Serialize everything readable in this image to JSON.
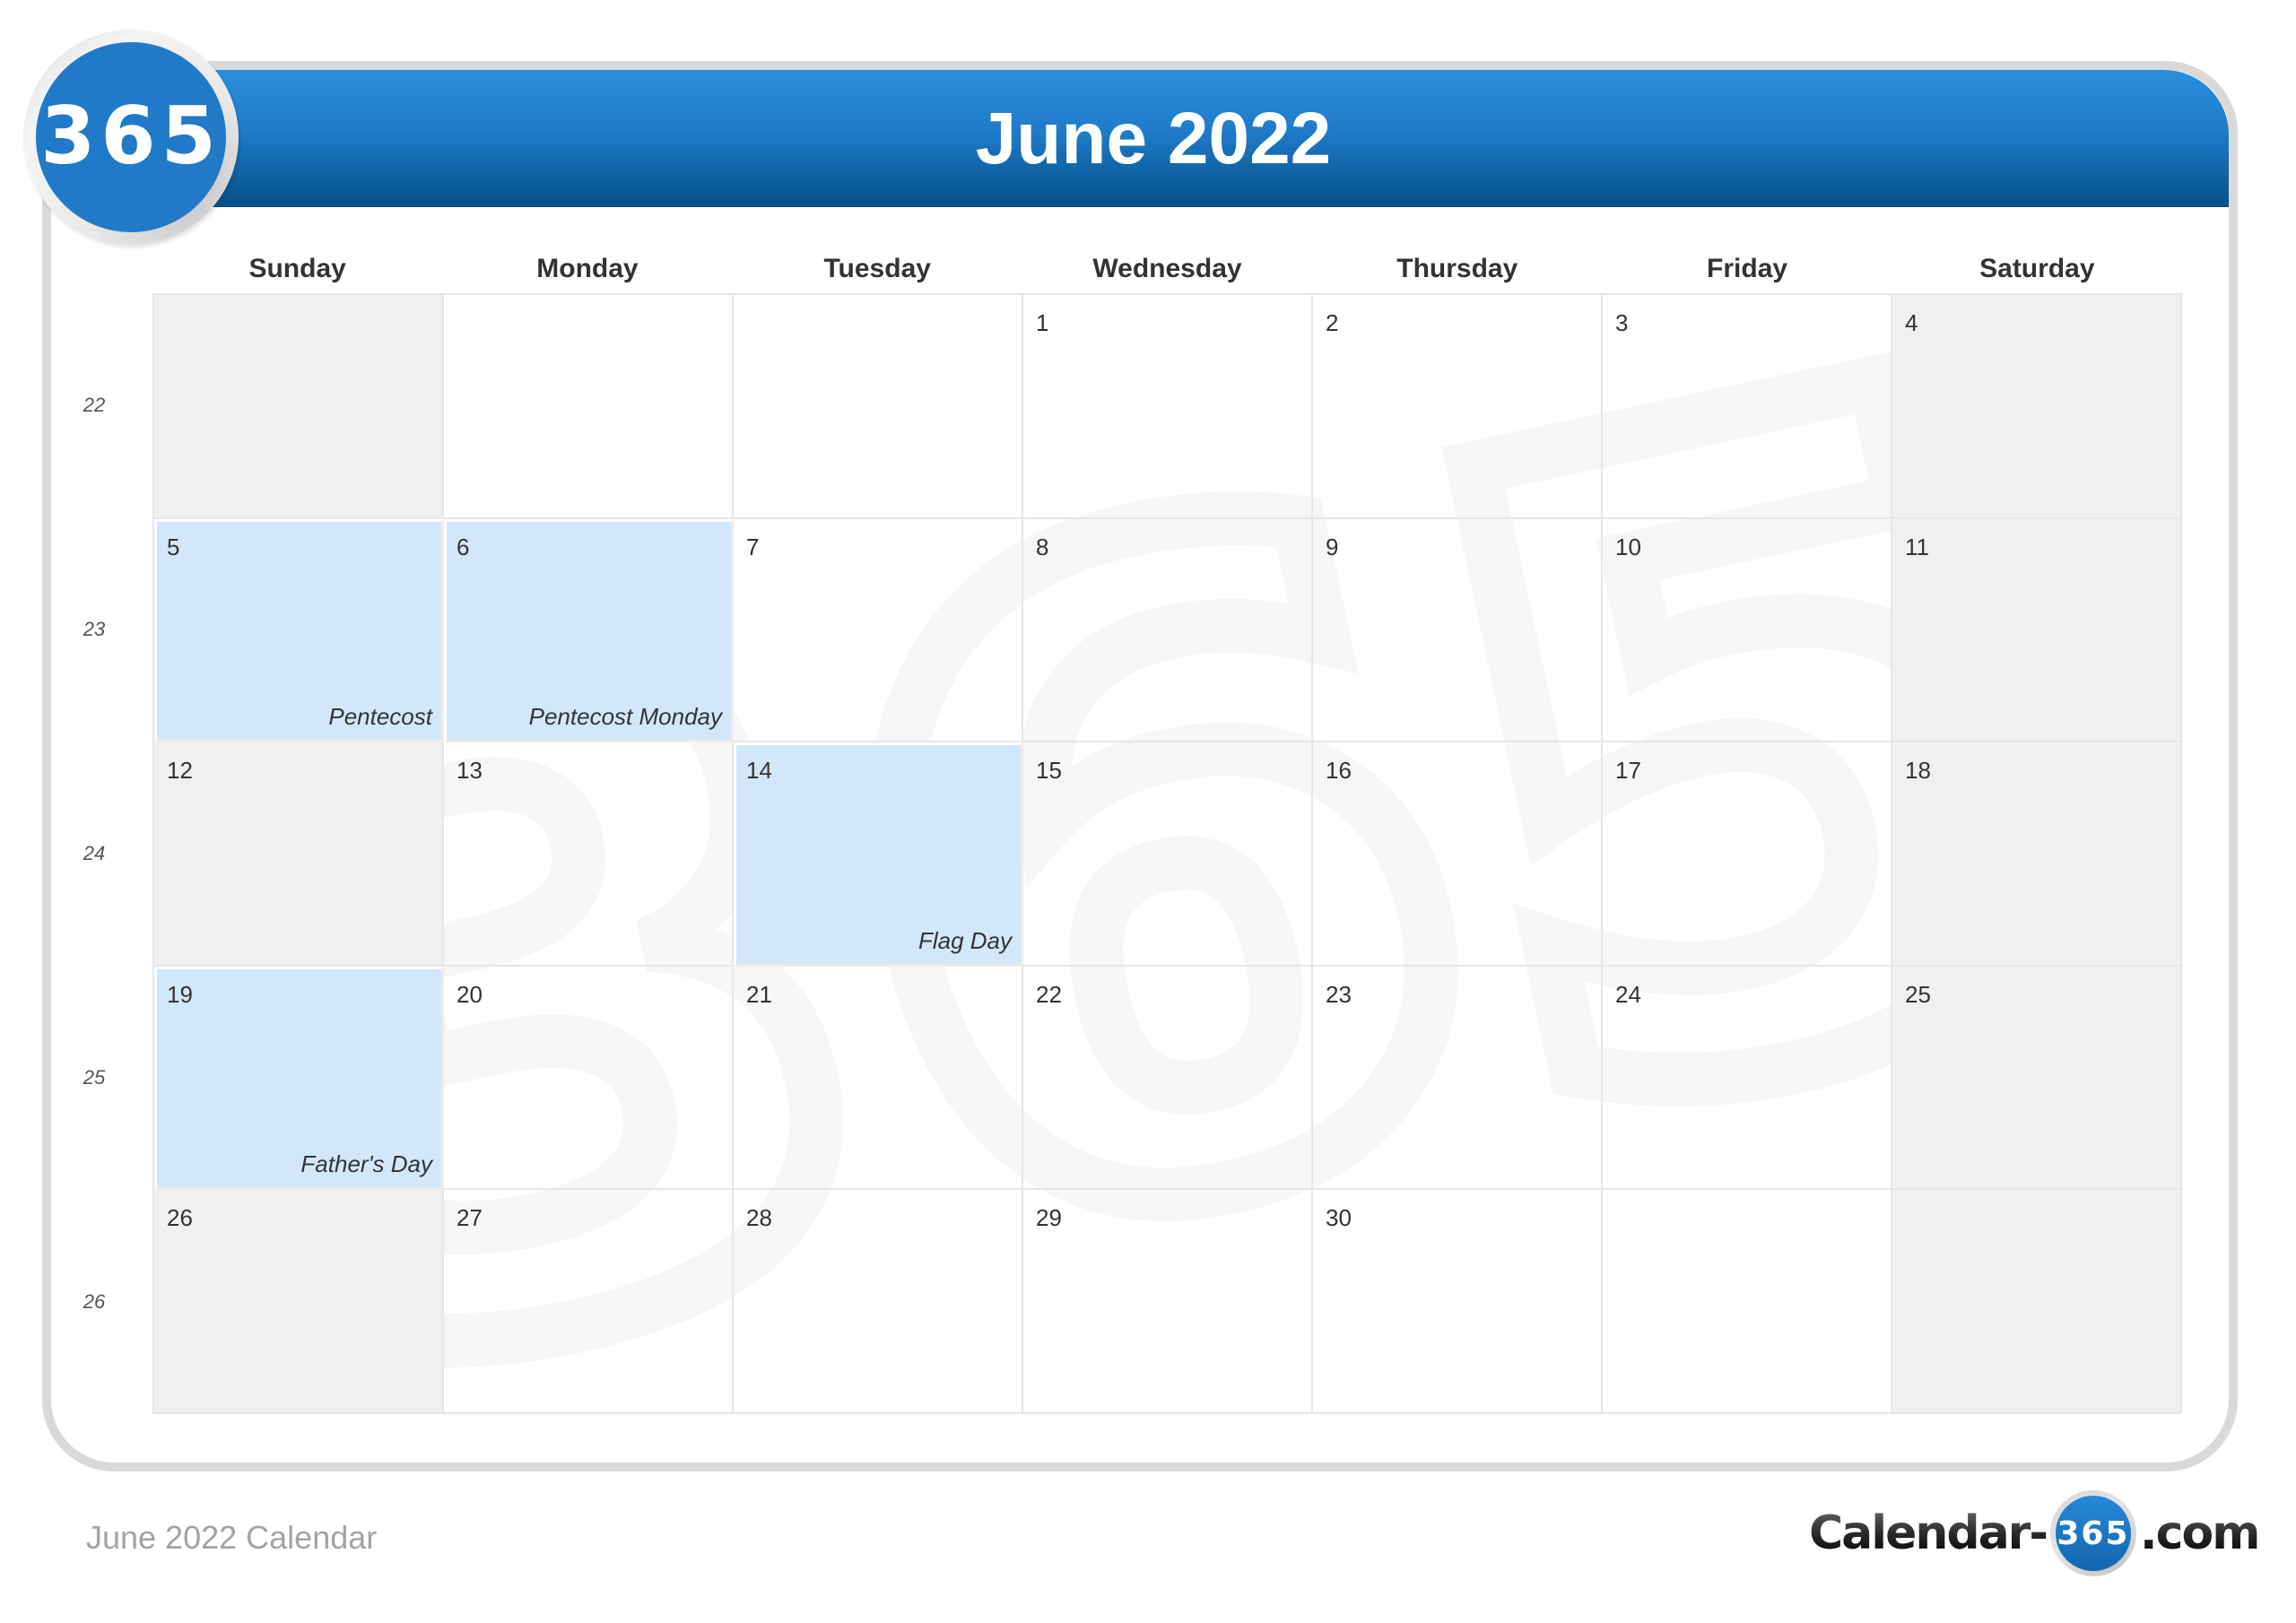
{
  "header": {
    "logo_text": "365",
    "title": "June 2022"
  },
  "colors": {
    "header_blue_top": "#2a8fde",
    "header_blue_bottom": "#075089",
    "holiday_fill": "#d3e7fa",
    "weekend_fill": "#f0f0f0",
    "frame_gray": "#d9d9d9"
  },
  "weekdays": [
    "Sunday",
    "Monday",
    "Tuesday",
    "Wednesday",
    "Thursday",
    "Friday",
    "Saturday"
  ],
  "week_numbers": [
    "22",
    "23",
    "24",
    "25",
    "26"
  ],
  "weeks": [
    [
      {
        "day": "",
        "weekend": true
      },
      {
        "day": ""
      },
      {
        "day": ""
      },
      {
        "day": "1"
      },
      {
        "day": "2"
      },
      {
        "day": "3"
      },
      {
        "day": "4",
        "weekend": true
      }
    ],
    [
      {
        "day": "5",
        "weekend": true,
        "holiday": "Pentecost"
      },
      {
        "day": "6",
        "holiday": "Pentecost Monday"
      },
      {
        "day": "7"
      },
      {
        "day": "8"
      },
      {
        "day": "9"
      },
      {
        "day": "10"
      },
      {
        "day": "11",
        "weekend": true
      }
    ],
    [
      {
        "day": "12",
        "weekend": true
      },
      {
        "day": "13"
      },
      {
        "day": "14",
        "holiday": "Flag Day"
      },
      {
        "day": "15"
      },
      {
        "day": "16"
      },
      {
        "day": "17"
      },
      {
        "day": "18",
        "weekend": true
      }
    ],
    [
      {
        "day": "19",
        "weekend": true,
        "holiday": "Father's Day"
      },
      {
        "day": "20"
      },
      {
        "day": "21"
      },
      {
        "day": "22"
      },
      {
        "day": "23"
      },
      {
        "day": "24"
      },
      {
        "day": "25",
        "weekend": true
      }
    ],
    [
      {
        "day": "26",
        "weekend": true
      },
      {
        "day": "27"
      },
      {
        "day": "28"
      },
      {
        "day": "29"
      },
      {
        "day": "30"
      },
      {
        "day": ""
      },
      {
        "day": "",
        "weekend": true
      }
    ]
  ],
  "footer": {
    "caption": "June 2022 Calendar",
    "brand_prefix": "Calendar-",
    "brand_number": "365",
    "brand_suffix": ".com"
  },
  "watermark_text": "365"
}
